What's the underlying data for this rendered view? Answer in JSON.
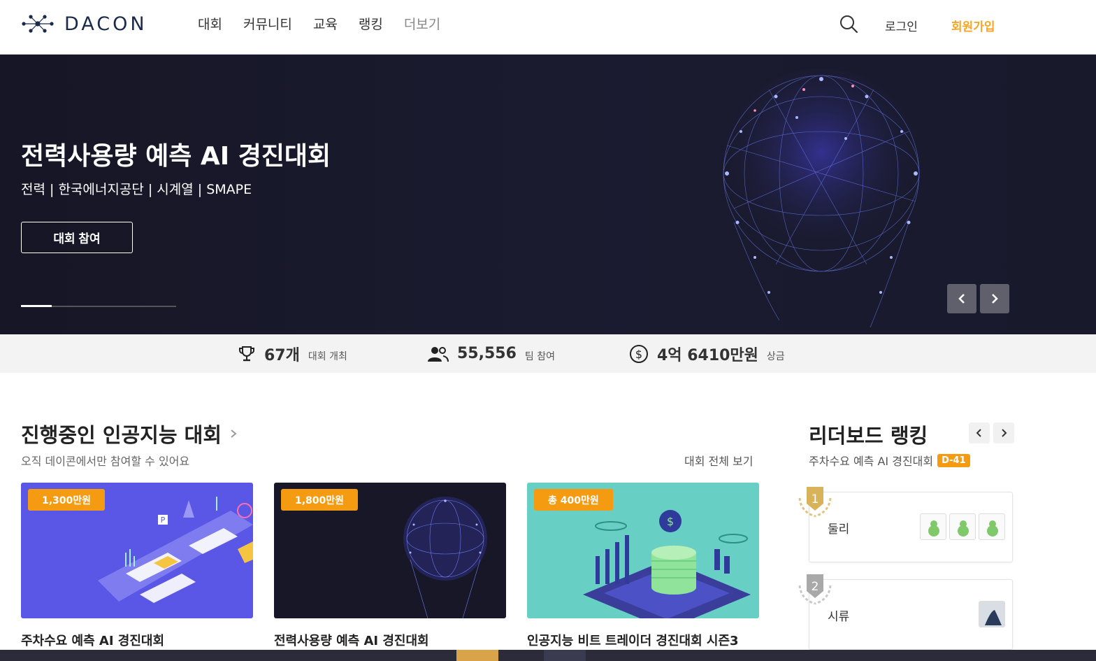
{
  "header": {
    "logo_text": "DACON",
    "nav": [
      "대회",
      "커뮤니티",
      "교육",
      "랭킹",
      "더보기"
    ],
    "login": "로그인",
    "signup": "회원가입"
  },
  "hero": {
    "title": "전력사용량 예측 AI 경진대회",
    "subtitle": "전력 | 한국에너지공단 | 시계열 | SMAPE",
    "button": "대회 참여"
  },
  "stats": [
    {
      "icon": "trophy-icon",
      "value": "67개",
      "label": "대회 개최"
    },
    {
      "icon": "people-icon",
      "value": "55,556",
      "label": "팀 참여"
    },
    {
      "icon": "dollar-icon",
      "value": "4억 6410만원",
      "label": "상금"
    }
  ],
  "competitions": {
    "title": "진행중인 인공지능 대회",
    "subtitle": "오직 데이콘에서만 참여할 수 있어요",
    "view_all": "대회 전체 보기",
    "cards": [
      {
        "prize": "1,300만원",
        "title": "주차수요 예측 AI 경진대회"
      },
      {
        "prize": "1,800만원",
        "title": "전력사용량 예측 AI 경진대회"
      },
      {
        "prize": "총 400만원",
        "title": "인공지능 비트 트레이더 경진대회 시즌3"
      }
    ]
  },
  "leaderboard": {
    "title": "리더보드 랭킹",
    "competition": "주차수요 예측 AI 경진대회",
    "dday": "D-41",
    "entries": [
      {
        "rank": "1",
        "name": "둘리"
      },
      {
        "rank": "2",
        "name": "시류"
      }
    ]
  },
  "colors": {
    "accent": "#f59b12",
    "signup": "#f5a623",
    "hero_bg": "#1b1b30",
    "logo": "#1a2a4a"
  }
}
